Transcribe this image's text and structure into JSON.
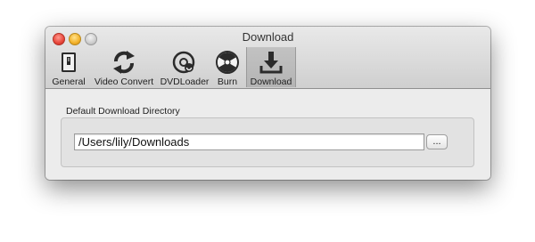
{
  "window": {
    "title": "Download"
  },
  "toolbar": {
    "items": [
      {
        "label": "General",
        "icon": "switch-icon"
      },
      {
        "label": "Video Convert",
        "icon": "refresh-arrows-icon"
      },
      {
        "label": "DVDLoader",
        "icon": "disc-icon"
      },
      {
        "label": "Burn",
        "icon": "radiation-icon"
      },
      {
        "label": "Download",
        "icon": "download-arrow-icon",
        "selected": true
      }
    ]
  },
  "download": {
    "group_label": "Default Download Directory",
    "directory_value": "/Users/lily/Downloads",
    "browse_label": "..."
  }
}
